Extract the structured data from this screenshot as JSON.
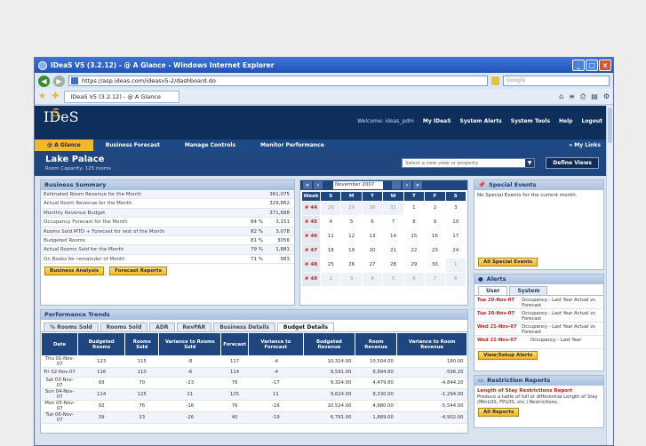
{
  "window": {
    "title": "IDeaS V5 (3.2.12) - @ A Glance - Windows Internet Explorer",
    "url": "https://asp.ideas.com/ideasv5-2/dashboard.do",
    "search_placeholder": "Google",
    "tab_title": "IDeaS V5 (3.2.12) - @ A Glance"
  },
  "header": {
    "logo_text": "IDeS",
    "logo_five": "5",
    "welcome": "Welcome: ideas_pdm",
    "links": [
      "My IDeaS",
      "System Alerts",
      "System Tools",
      "Help",
      "Logout"
    ]
  },
  "nav": {
    "tabs": [
      "@ A Glance",
      "Business Forecast",
      "Manage Controls",
      "Monitor Performance"
    ],
    "my_links": "» My Links"
  },
  "property": {
    "name": "Lake Palace",
    "capacity": "Room Capacity: 125 rooms",
    "view_placeholder": "Select a new view or property",
    "define_views": "Define Views"
  },
  "business_summary": {
    "title": "Business Summary",
    "rows": [
      {
        "label": "Estimated Room Revenue for the Month",
        "v1": "",
        "v2": "361,075"
      },
      {
        "label": "Actual Room Revenue for the Month",
        "v1": "",
        "v2": "329,862"
      },
      {
        "label": "Monthly Revenue Budget",
        "v1": "",
        "v2": "371,688"
      },
      {
        "label": "Occupancy Forecast for the Month",
        "v1": "84 %",
        "v2": "3,151"
      },
      {
        "label": "Rooms Sold MTD + Forecast for rest of the Month",
        "v1": "82 %",
        "v2": "3,078"
      },
      {
        "label": "Budgeted Rooms",
        "v1": "81 %",
        "v2": "3056"
      },
      {
        "label": "Actual Rooms Sold for the Month",
        "v1": "79 %",
        "v2": "1,881"
      },
      {
        "label": "On Books for remainder of Month",
        "v1": "71 %",
        "v2": "983"
      }
    ],
    "buttons": [
      "Business Analysis",
      "Forecast Reports"
    ]
  },
  "calendar": {
    "month": "November 2007",
    "headers": [
      "Week",
      "S",
      "M",
      "T",
      "W",
      "T",
      "F",
      "S"
    ],
    "weeks": [
      {
        "wk": "# 44",
        "days": [
          "28",
          "29",
          "30",
          "31",
          "1",
          "2",
          "3"
        ]
      },
      {
        "wk": "# 45",
        "days": [
          "4",
          "5",
          "6",
          "7",
          "8",
          "9",
          "10"
        ]
      },
      {
        "wk": "# 46",
        "days": [
          "11",
          "12",
          "13",
          "14",
          "15",
          "16",
          "17"
        ]
      },
      {
        "wk": "# 47",
        "days": [
          "18",
          "19",
          "20",
          "21",
          "22",
          "23",
          "24"
        ]
      },
      {
        "wk": "# 48",
        "days": [
          "25",
          "26",
          "27",
          "28",
          "29",
          "30",
          "1"
        ]
      },
      {
        "wk": "# 49",
        "days": [
          "2",
          "3",
          "4",
          "5",
          "6",
          "7",
          "8"
        ]
      }
    ]
  },
  "special_events": {
    "title": "Special Events",
    "text": "No Special Events for the current month.",
    "button": "All Special Events"
  },
  "alerts": {
    "title": "Alerts",
    "tabs": [
      "User",
      "System"
    ],
    "rows": [
      {
        "date": "Tue 20-Nov-07",
        "msg": "Occupancy - Last Year Actual vs Forecast"
      },
      {
        "date": "Tue 20-Nov-07",
        "msg": "Occupancy - Last Year Actual vs Forecast"
      },
      {
        "date": "Wed 21-Nov-07",
        "msg": "Occupancy - Last Year Actual vs Forecast"
      },
      {
        "date": "Wed 21-Nov-07",
        "msg": "Occupancy - Last Year"
      }
    ],
    "button": "View/Setup Alerts"
  },
  "restriction": {
    "title": "Restriction Reports",
    "report_title": "Length of Stay Restrictions Report",
    "desc": "Produce a table of full or differential Length of Stay (MinLOS, FPLOS, etc.) Restrictions.",
    "button": "All Reports"
  },
  "performance": {
    "title": "Performance Trends",
    "tabs": [
      "% Rooms Sold",
      "Rooms Sold",
      "ADR",
      "RevPAR",
      "Business Details",
      "Budget Details"
    ],
    "columns": [
      "Date",
      "Budgeted Rooms",
      "Rooms Sold",
      "Variance to Rooms Sold",
      "Forecast",
      "Variance to Forecast",
      "Budgeted Revenue",
      "Room Revenue",
      "Variance to Room Revenue"
    ],
    "rows": [
      [
        "Thu 01-Nov-07",
        "123",
        "115",
        "-8",
        "117",
        "-4",
        "10,324.00",
        "10,504.00",
        "180.00"
      ],
      [
        "Fri 02-Nov-07",
        "116",
        "110",
        "-6",
        "114",
        "-4",
        "9,591.00",
        "8,994.80",
        "-596.20"
      ],
      [
        "Sat 03-Nov-07",
        "93",
        "70",
        "-23",
        "76",
        "-17",
        "9,324.00",
        "4,479.80",
        "-4,844.20"
      ],
      [
        "Sun 04-Nov-07",
        "114",
        "125",
        "11",
        "125",
        "11",
        "9,624.00",
        "8,330.00",
        "-1,294.00"
      ],
      [
        "Mon 05-Nov-07",
        "92",
        "76",
        "-16",
        "76",
        "-16",
        "10,524.00",
        "4,980.00",
        "-5,544.00"
      ],
      [
        "Tue 06-Nov-07",
        "39",
        "23",
        "-26",
        "40",
        "-19",
        "6,791.00",
        "1,889.00",
        "-4,902.00"
      ]
    ]
  }
}
